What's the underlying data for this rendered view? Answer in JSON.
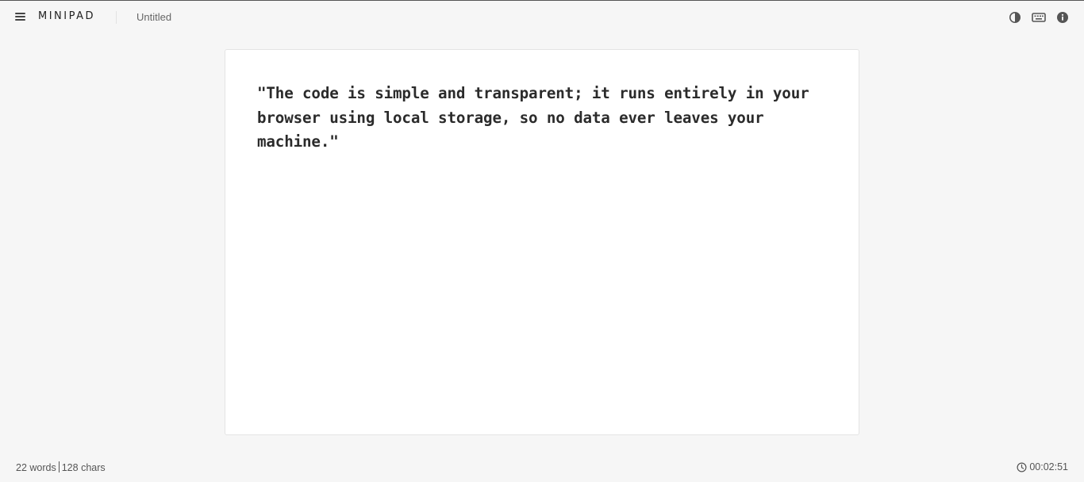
{
  "header": {
    "brand": "MINIPAD",
    "document_title": "Untitled",
    "menu_icon": "hamburger-menu-icon",
    "icons": [
      "contrast-icon",
      "keyboard-icon",
      "info-icon"
    ]
  },
  "editor": {
    "content": "\"The code is simple and transparent; it runs entirely in your browser using local storage, so no data ever leaves your machine.\""
  },
  "footer": {
    "words": "22 words",
    "chars": "128 chars",
    "timer": "00:02:51",
    "timer_icon": "clock-icon"
  },
  "colors": {
    "background": "#f6f6f6",
    "editor_background": "#ffffff",
    "text": "#2b2b2b",
    "icon": "#555555"
  }
}
